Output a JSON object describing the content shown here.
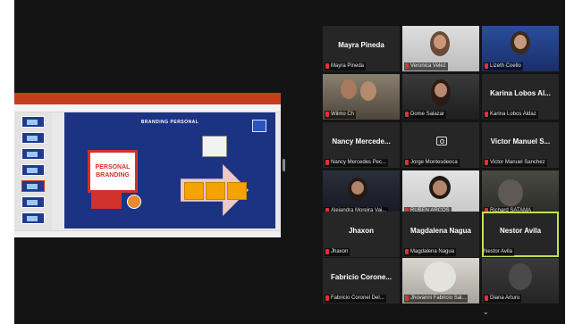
{
  "slide": {
    "title": "BRANDING PERSONAL",
    "pb_line1": "PERSONAL",
    "pb_line2": "BRANDING"
  },
  "participants": [
    {
      "name": "Mayra Pineda",
      "label": "Mayra Pineda",
      "video": false
    },
    {
      "name": "",
      "label": "Veronica Velez",
      "video": true
    },
    {
      "name": "",
      "label": "Lizeth Coello",
      "video": true
    },
    {
      "name": "",
      "label": "Wilmo Ch",
      "video": true
    },
    {
      "name": "",
      "label": "Dome Salazar",
      "video": true
    },
    {
      "name": "Karina Lobos Al...",
      "label": "Karina Lobos Aldaz",
      "video": false
    },
    {
      "name": "Nancy Mercede...",
      "label": "Nancy Mercedes Pec...",
      "video": false
    },
    {
      "name": "",
      "label": "Jorge Montesdeoca",
      "video": false
    },
    {
      "name": "Victor Manuel S...",
      "label": "Victor Manuel Sanchez",
      "video": false
    },
    {
      "name": "",
      "label": "Alejandra Moreira Vai...",
      "video": true
    },
    {
      "name": "",
      "label": "RUBEN ARCOS",
      "video": true
    },
    {
      "name": "",
      "label": "Richard SATAMA",
      "video": true
    },
    {
      "name": "Jhaxon",
      "label": "Jhaxon",
      "video": false
    },
    {
      "name": "Magdalena Nagua",
      "label": "Magdalena Nagua",
      "video": false
    },
    {
      "name": "Nestor Avila",
      "label": "Nestor Avila",
      "video": false
    },
    {
      "name": "Fabricio Corone...",
      "label": "Fabricio Coronel Del...",
      "video": false
    },
    {
      "name": "",
      "label": "Jhovanni Fabricio Sal...",
      "video": true
    },
    {
      "name": "",
      "label": "Diana Arturo",
      "video": true
    }
  ]
}
